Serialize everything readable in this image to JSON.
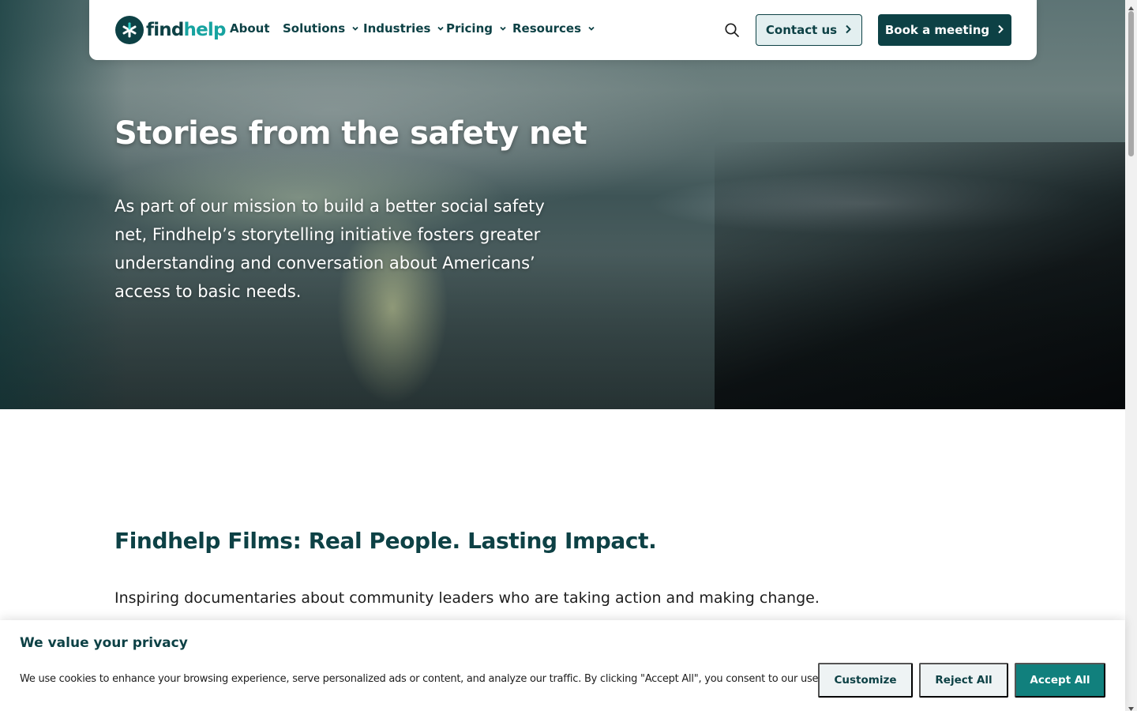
{
  "brand": {
    "logo_find": "find",
    "logo_help": "help",
    "colors": {
      "primary": "#0d4145",
      "accent": "#17a3a0",
      "accept": "#11807d"
    }
  },
  "nav": {
    "items": [
      {
        "label": "About",
        "has_dropdown": false
      },
      {
        "label": "Solutions",
        "has_dropdown": true
      },
      {
        "label": "Industries",
        "has_dropdown": true
      },
      {
        "label": "Pricing",
        "has_dropdown": true
      },
      {
        "label": "Resources",
        "has_dropdown": true
      }
    ],
    "search_icon": "search-icon",
    "contact_label": "Contact us",
    "book_label": "Book a meeting"
  },
  "hero": {
    "title": "Stories from the safety net",
    "body": "As part of our mission to build a better social safety net, Findhelp’s storytelling initiative fosters greater understanding and conversation about Americans’ access to basic needs."
  },
  "films": {
    "title": "Findhelp Films: Real People. Lasting Impact.",
    "description": "Inspiring documentaries about community leaders who are taking action and making change."
  },
  "cookie_banner": {
    "title": "We value your privacy",
    "text": "We use cookies to enhance your browsing experience, serve personalized ads or content, and analyze our traffic. By clicking \"Accept All\", you consent to our use of cookies.",
    "customize_label": "Customize",
    "reject_label": "Reject All",
    "accept_label": "Accept All"
  }
}
